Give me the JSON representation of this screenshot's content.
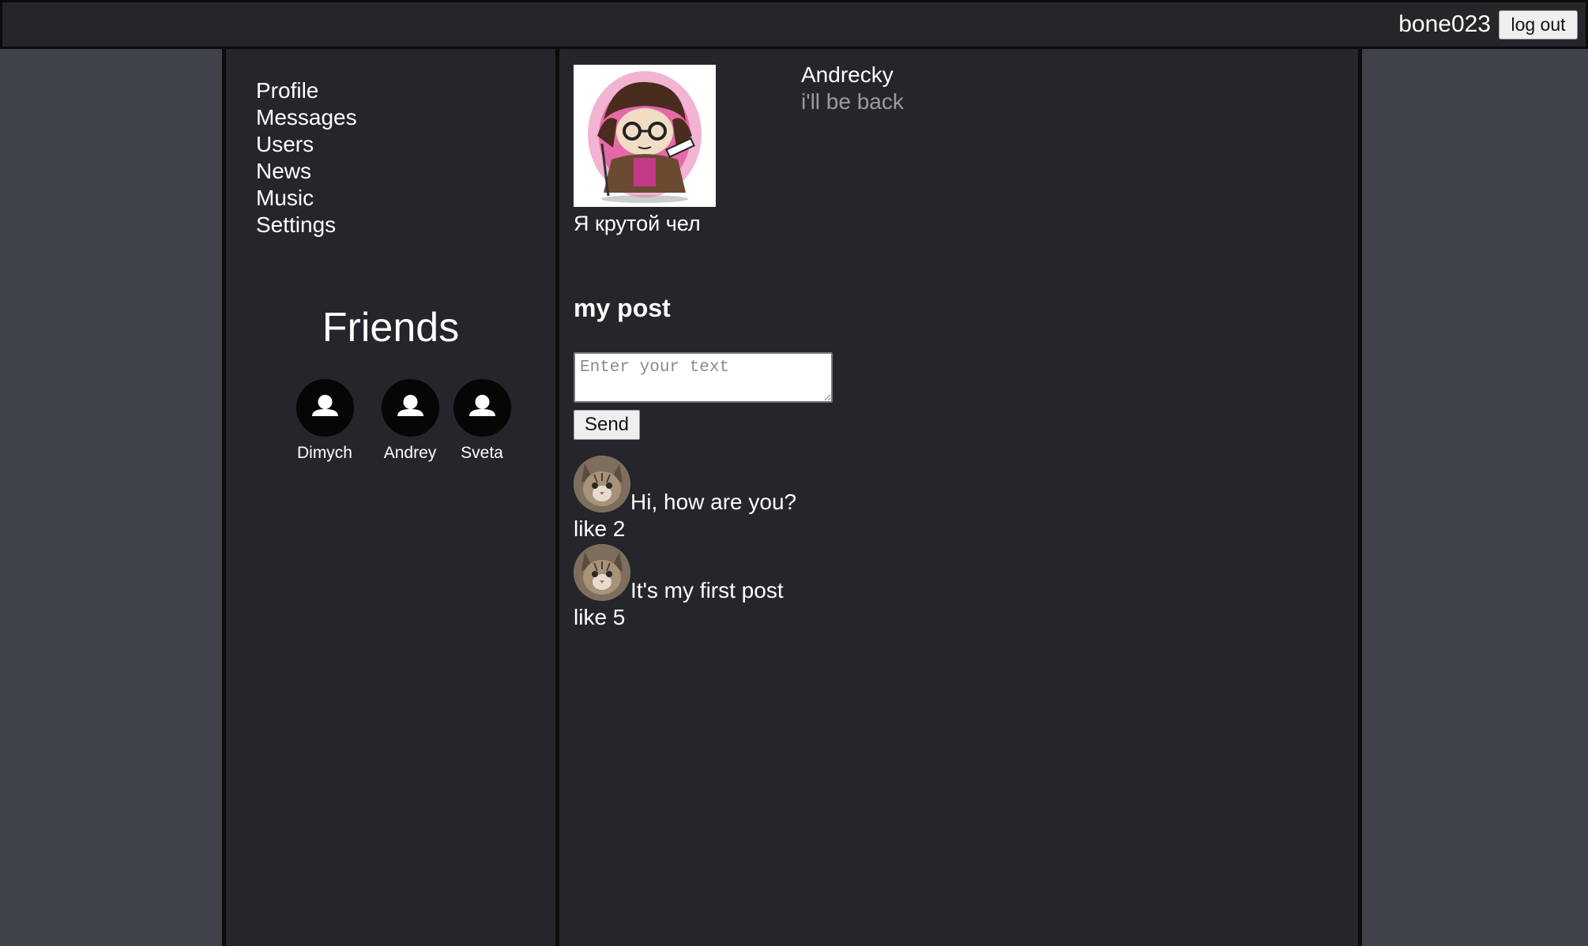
{
  "header": {
    "username": "bone023",
    "logout_label": "log out"
  },
  "sidebar": {
    "nav": [
      {
        "label": "Profile"
      },
      {
        "label": "Messages"
      },
      {
        "label": "Users"
      },
      {
        "label": "News"
      },
      {
        "label": "Music"
      },
      {
        "label": "Settings"
      }
    ],
    "friends_title": "Friends",
    "friends": [
      {
        "name": "Dimych",
        "icon": "user-icon"
      },
      {
        "name": "Andrey",
        "icon": "user-icon"
      },
      {
        "name": "Sveta",
        "icon": "user-icon"
      }
    ]
  },
  "profile": {
    "name": "Andrecky",
    "status": "i'll be back",
    "bio": "Я крутой чел"
  },
  "posts": {
    "title": "my post",
    "input_placeholder": "Enter your text",
    "input_value": "",
    "send_label": "Send",
    "items": [
      {
        "text": "Hi, how are you?",
        "likes": "like 2"
      },
      {
        "text": "It's my first post",
        "likes": "like 5"
      }
    ]
  },
  "colors": {
    "page_bg": "#3f414b",
    "panel_bg": "#25252b",
    "status_text": "#9a9aa0"
  }
}
